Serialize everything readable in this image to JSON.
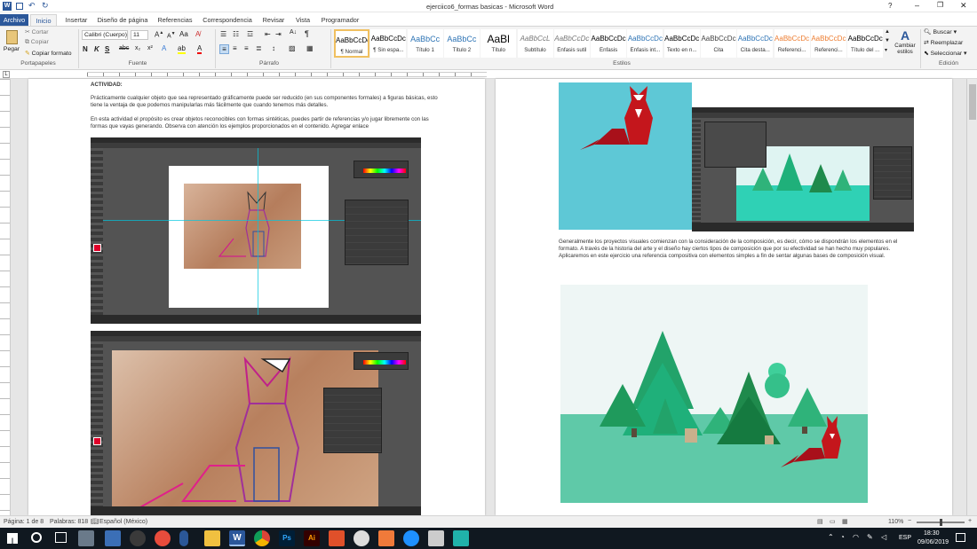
{
  "titlebar": {
    "title": "ejerciico6_formas basicas - Microsoft Word",
    "controls": [
      "?",
      "–",
      "❐",
      "✕"
    ]
  },
  "tabs": [
    "Archivo",
    "Inicio",
    "Insertar",
    "Diseño de página",
    "Referencias",
    "Correspondencia",
    "Revisar",
    "Vista",
    "Programador"
  ],
  "ribbon": {
    "clipboard": {
      "paste": "Pegar",
      "cut": "Cortar",
      "copy": "Copiar",
      "format_painter": "Copiar formato",
      "label": "Portapapeles"
    },
    "font": {
      "name": "Calibri (Cuerpo)",
      "size": "11",
      "label": "Fuente"
    },
    "paragraph": {
      "label": "Párrafo"
    },
    "styles": {
      "label": "Estilos",
      "items": [
        {
          "sample": "AaBbCcDc",
          "name": "¶ Normal"
        },
        {
          "sample": "AaBbCcDc",
          "name": "¶ Sin espa..."
        },
        {
          "sample": "AaBbCc",
          "name": "Título 1"
        },
        {
          "sample": "AaBbCc",
          "name": "Título 2"
        },
        {
          "sample": "AaBl",
          "name": "Título"
        },
        {
          "sample": "AaBbCcL",
          "name": "Subtítulo"
        },
        {
          "sample": "AaBbCcDc",
          "name": "Énfasis sutil"
        },
        {
          "sample": "AaBbCcDc",
          "name": "Énfasis"
        },
        {
          "sample": "AaBbCcDc",
          "name": "Énfasis int..."
        },
        {
          "sample": "AaBbCcDc",
          "name": "Texto en n..."
        },
        {
          "sample": "AaBbCcDc",
          "name": "Cita"
        },
        {
          "sample": "AaBbCcDc",
          "name": "Cita desta..."
        },
        {
          "sample": "AaBbCcDc",
          "name": "Referenci..."
        },
        {
          "sample": "AaBbCcDc",
          "name": "Referenci..."
        },
        {
          "sample": "AaBbCcDc",
          "name": "Título del ..."
        }
      ],
      "change": "Cambiar estilos"
    },
    "edit": {
      "find": "Buscar",
      "replace": "Reemplazar",
      "select": "Seleccionar",
      "label": "Edición"
    }
  },
  "page1": {
    "heading": "ACTIVIDAD:",
    "p1": "Prácticamente cualquier objeto que sea representado gráficamente puede ser reducido (en sus componentes formales) a figuras básicas, esto tiene la ventaja de que podemos manipularlas más fácilmente que cuando tenemos más detalles.",
    "p2": "En esta actividad el propósito es crear objetos reconocibles con formas sintéticas, puedes partir de referencias y/o jugar libremente con las formas que vayas generando. Observa con atención los ejemplos proporcionados en el contenido. Agregar enlace"
  },
  "page2": {
    "p1": "Generalmente los proyectos visuales comienzan con la consideración de la composición, es decir, cómo se dispondrán los elementos en el formato.  A través de la historia del arte y el diseño hay ciertos tipos de composición que por su efectividad se han hecho muy populares. Aplicaremos en este ejercicio una referencia compositiva con elementos simples a fin de sentar algunas bases de composición visual."
  },
  "status": {
    "page": "Página: 1 de 8",
    "words": "Palabras: 818",
    "language": "Español (México)",
    "zoom": "110%"
  },
  "taskbar": {
    "lang": "ESP",
    "time": "18:30",
    "date": "09/06/2019"
  },
  "colors": {
    "accent": "#2b579a",
    "fox": "#c4161c",
    "tree_dark": "#1f8a4c",
    "tree_light": "#2fb37a",
    "water": "#5fc9a8",
    "sky": "#5ec8d6"
  }
}
